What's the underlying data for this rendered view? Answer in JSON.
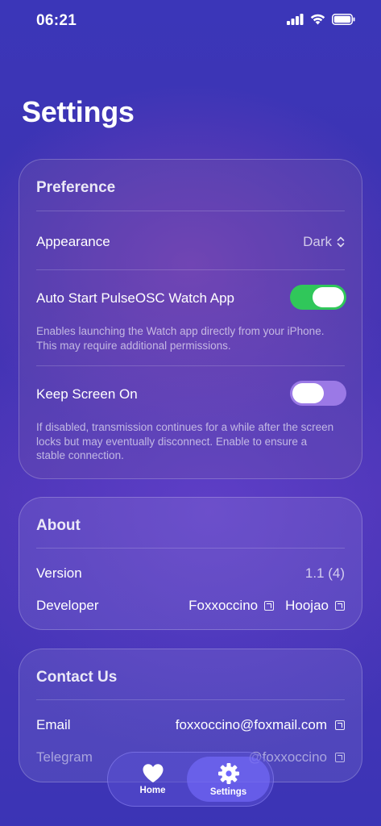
{
  "status": {
    "time": "06:21"
  },
  "page": {
    "title": "Settings"
  },
  "preference": {
    "header": "Preference",
    "appearance": {
      "label": "Appearance",
      "value": "Dark"
    },
    "auto_start": {
      "label": "Auto Start PulseOSC Watch App",
      "enabled": true,
      "description": "Enables launching the Watch app directly from your iPhone. This may require additional permissions."
    },
    "keep_screen_on": {
      "label": "Keep Screen On",
      "enabled": false,
      "description": "If disabled, transmission continues for a while after the screen locks but may eventually disconnect. Enable to ensure a stable connection."
    }
  },
  "about": {
    "header": "About",
    "version": {
      "label": "Version",
      "value": "1.1 (4)"
    },
    "developer": {
      "label": "Developer",
      "links": [
        "Foxxoccino",
        "Hoojao"
      ]
    }
  },
  "contact": {
    "header": "Contact Us",
    "email": {
      "label": "Email",
      "value": "foxxoccino@foxmail.com"
    },
    "telegram": {
      "label": "Telegram",
      "value": "@foxxoccino"
    }
  },
  "tabs": [
    {
      "label": "Home",
      "icon": "heart-icon"
    },
    {
      "label": "Settings",
      "icon": "gear-icon",
      "selected": true
    }
  ],
  "colors": {
    "toggle_on": "#30c75a",
    "toggle_off": "#9b79e6",
    "tab_selected": "#6f66ff"
  }
}
